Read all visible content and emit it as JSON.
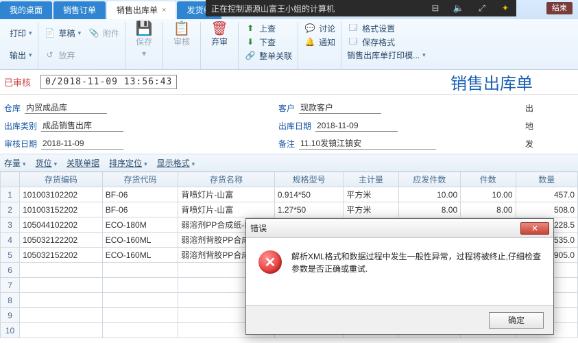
{
  "remote": {
    "notice": "正在控制源源山富王小姐的计算机",
    "end": "结束"
  },
  "tabs": {
    "desktop": "我的桌面",
    "sales_order": "销售订单",
    "sales_out": "销售出库单",
    "delivery": "发货单"
  },
  "ribbon": {
    "print": "打印",
    "output": "输出",
    "draft": "草稿",
    "attach": "附件",
    "release": "放弃",
    "save": "保存",
    "audit": "审核",
    "discard": "弃审",
    "upcheck": "上查",
    "downcheck": "下查",
    "related": "整单关联",
    "discuss": "讨论",
    "notify": "通知",
    "format_set": "格式设置",
    "save_format": "保存格式",
    "print_template": "销售出库单打印模..."
  },
  "status": {
    "approved": "已审核",
    "timestamp": "0/2018-11-09 13:56:43",
    "title": "销售出库单"
  },
  "form": {
    "warehouse_label": "仓库",
    "warehouse_value": "内贸成品库",
    "out_type_label": "出库类别",
    "out_type_value": "成品销售出库",
    "audit_date_label": "审核日期",
    "audit_date_value": "2018-11-09",
    "customer_label": "客户",
    "customer_value": "现款客户",
    "out_date_label": "出库日期",
    "out_date_value": "2018-11-09",
    "remark_label": "备注",
    "remark_value": "11.10发镇江镇安",
    "right1": "出",
    "right2": "地",
    "right3": "发"
  },
  "subtoolbar": {
    "stock": "存量",
    "location": "货位",
    "related": "关联单据",
    "sort": "排序定位",
    "display": "显示格式"
  },
  "table": {
    "headers": [
      "存货编码",
      "存货代码",
      "存货名称",
      "规格型号",
      "主计量",
      "应发件数",
      "件数",
      "数量"
    ],
    "rows": [
      {
        "code": "101003102202",
        "alias": "BF-06",
        "name": "背喷灯片-山富",
        "spec": "0.914*50",
        "unit": "平方米",
        "should": "10.00",
        "pcs": "10.00",
        "qty": "457.0"
      },
      {
        "code": "101003152202",
        "alias": "BF-06",
        "name": "背喷灯片-山富",
        "spec": "1.27*50",
        "unit": "平方米",
        "should": "8.00",
        "pcs": "8.00",
        "qty": "508.0"
      },
      {
        "code": "105044102202",
        "alias": "ECO-180M",
        "name": "弱溶剂PP合成纸-山",
        "spec": "",
        "unit": "",
        "should": "",
        "pcs": "",
        "qty": "228.5"
      },
      {
        "code": "105032122202",
        "alias": "ECO-160ML",
        "name": "弱溶剂背胶PP合成",
        "spec": "",
        "unit": "",
        "should": "",
        "pcs": "",
        "qty": "535.0"
      },
      {
        "code": "105032152202",
        "alias": "ECO-160ML",
        "name": "弱溶剂背胶PP合成",
        "spec": "",
        "unit": "",
        "should": "",
        "pcs": "",
        "qty": "1905.0"
      }
    ]
  },
  "dialog": {
    "title": "错误",
    "message": "解析XML格式和数据过程中发生一般性异常，过程将被终止,仔细检查参数是否正确或重试.",
    "ok": "确定"
  }
}
